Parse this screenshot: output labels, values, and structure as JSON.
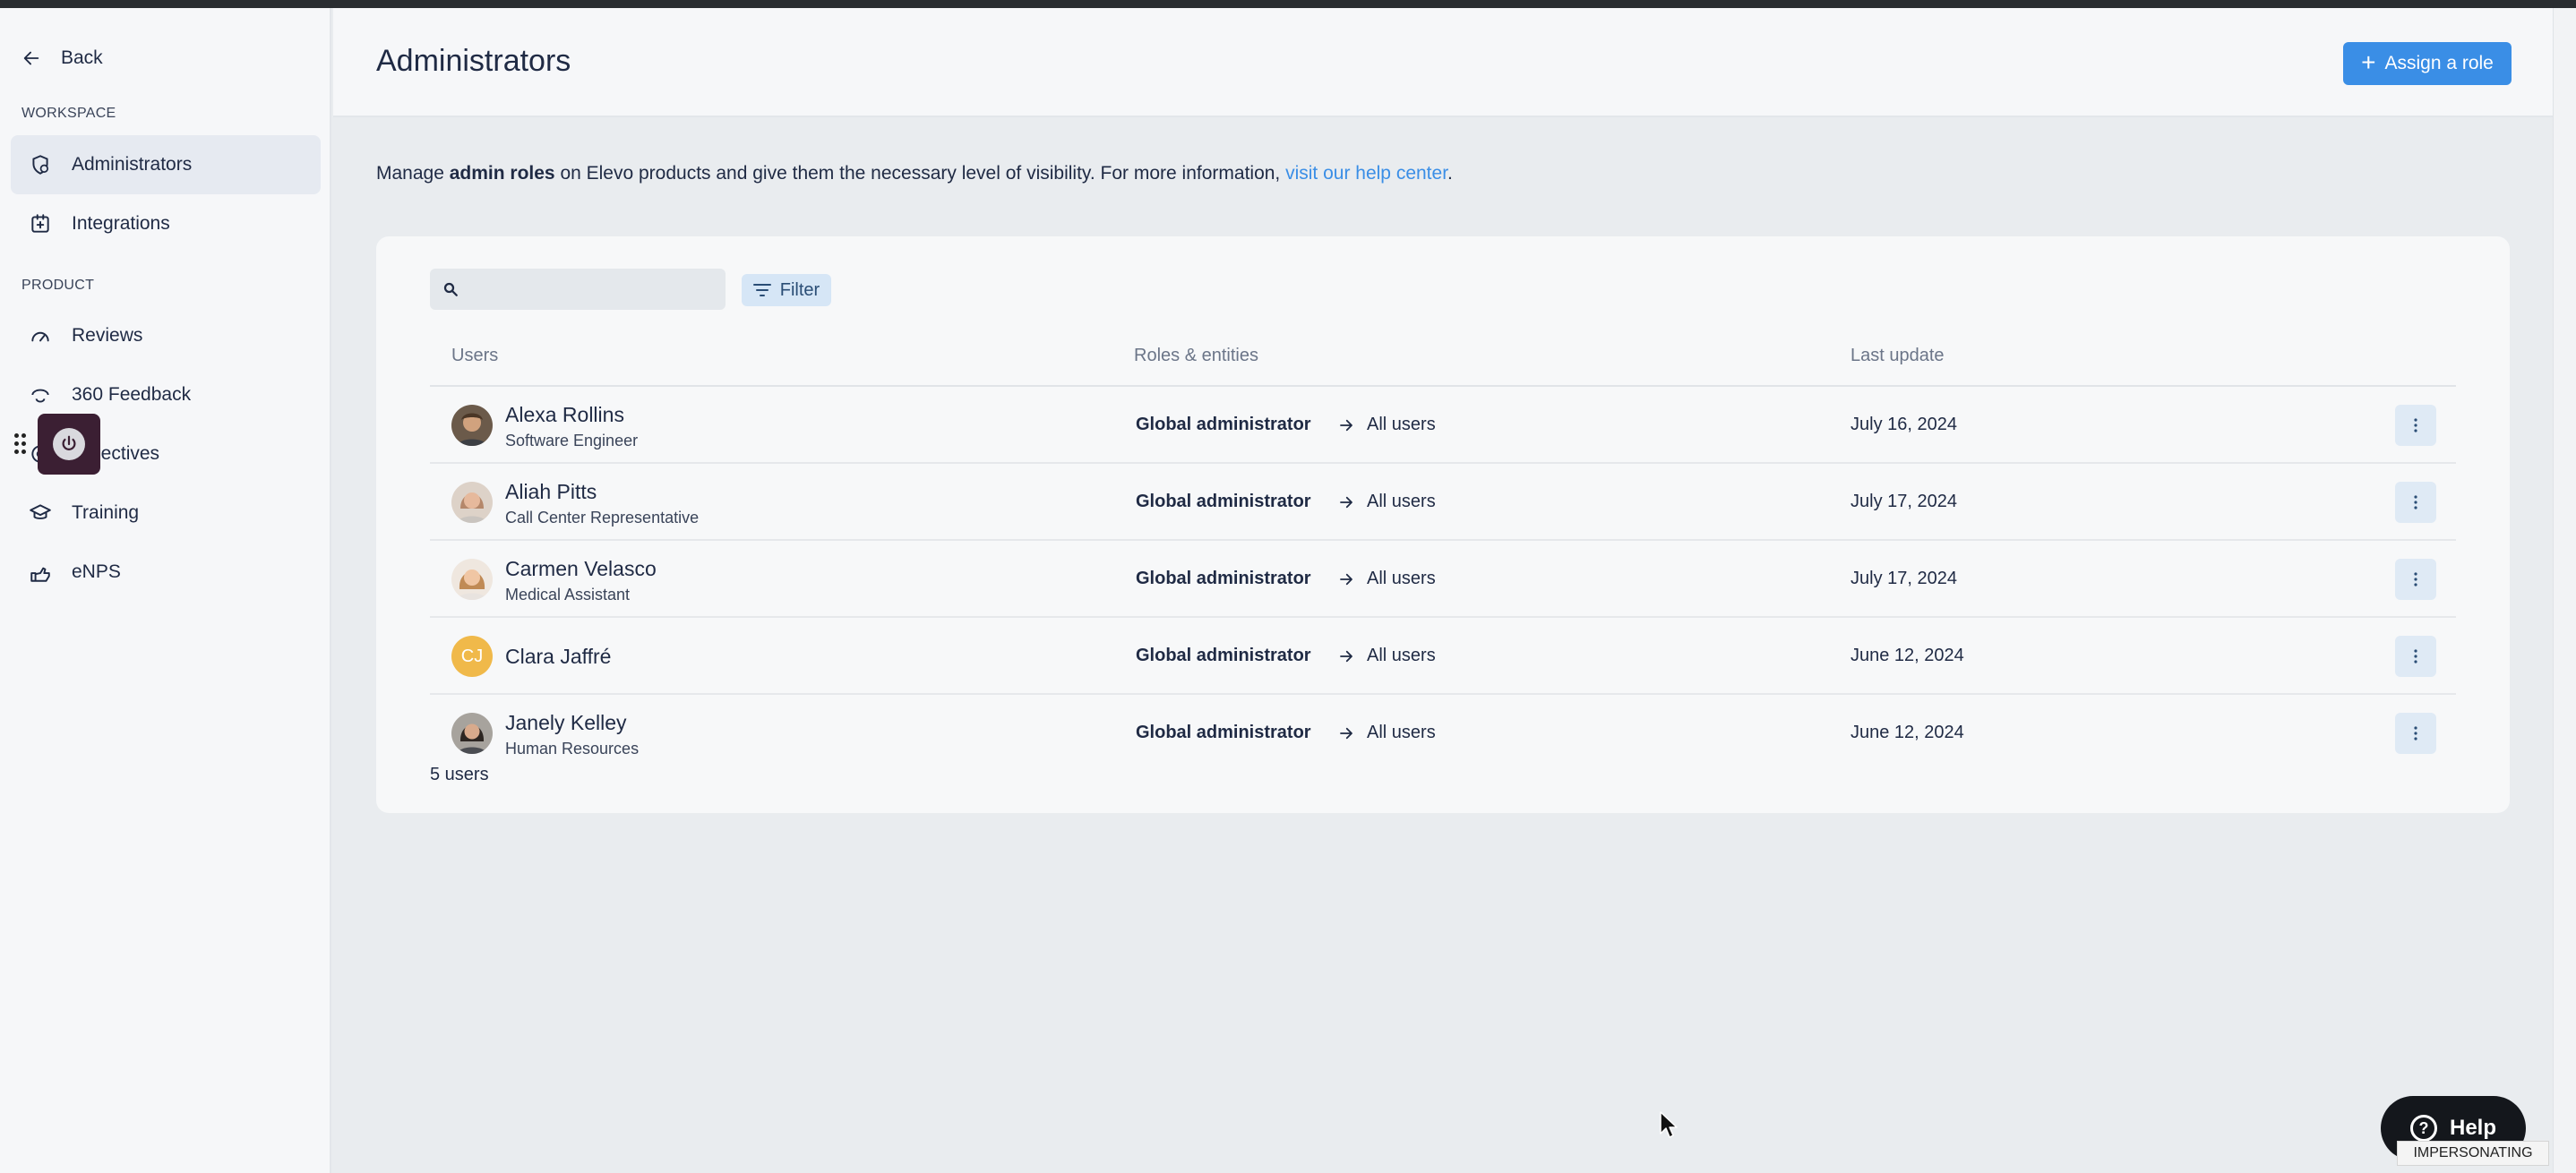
{
  "sidebar": {
    "back_label": "Back",
    "workspace_label": "WORKSPACE",
    "product_label": "PRODUCT",
    "workspace_items": [
      {
        "label": "Administrators",
        "icon": "shield-icon",
        "active": true
      },
      {
        "label": "Integrations",
        "icon": "integrations-icon",
        "active": false
      }
    ],
    "product_items": [
      {
        "label": "Reviews",
        "icon": "reviews-icon"
      },
      {
        "label": "360 Feedback",
        "icon": "feedback-icon"
      },
      {
        "label": "Objectives",
        "icon": "objectives-icon"
      },
      {
        "label": "Training",
        "icon": "training-icon"
      },
      {
        "label": "eNPS",
        "icon": "enps-icon"
      }
    ]
  },
  "header": {
    "title": "Administrators",
    "assign_button": "Assign a role"
  },
  "intro": {
    "prefix": "Manage ",
    "bold": "admin roles",
    "middle": " on Elevo products and give them the necessary level of visibility. For more information, ",
    "link": "visit our help center",
    "suffix": "."
  },
  "toolbar": {
    "search_value": "",
    "filter_label": "Filter"
  },
  "table": {
    "headers": {
      "users": "Users",
      "roles": "Roles & entities",
      "last_update": "Last update"
    },
    "rows": [
      {
        "name": "Alexa Rollins",
        "title": "Software Engineer",
        "initials": "",
        "role": "Global administrator",
        "entity": "All users",
        "date": "July 16, 2024"
      },
      {
        "name": "Aliah Pitts",
        "title": "Call Center Representative",
        "initials": "",
        "role": "Global administrator",
        "entity": "All users",
        "date": "July 17, 2024"
      },
      {
        "name": "Carmen Velasco",
        "title": "Medical Assistant",
        "initials": "",
        "role": "Global administrator",
        "entity": "All users",
        "date": "July 17, 2024"
      },
      {
        "name": "Clara Jaffré",
        "title": "",
        "initials": "CJ",
        "role": "Global administrator",
        "entity": "All users",
        "date": "June 12, 2024"
      },
      {
        "name": "Janely Kelley",
        "title": "Human Resources",
        "initials": "",
        "role": "Global administrator",
        "entity": "All users",
        "date": "June 12, 2024"
      }
    ],
    "count_label": "5 users"
  },
  "help": {
    "label": "Help"
  },
  "impersonating": "IMPERSONATING",
  "colors": {
    "accent": "#3a8ee6",
    "initials_avatar": "#f0b94a"
  }
}
